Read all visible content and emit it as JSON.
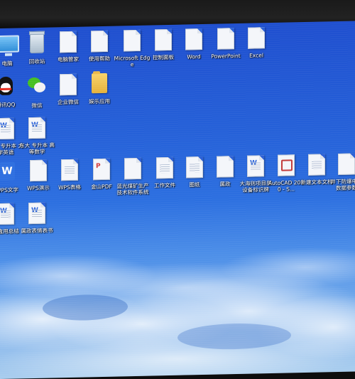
{
  "desktop": {
    "row1": [
      {
        "label": "电脑",
        "icon": "computer-icon"
      },
      {
        "label": "回收站",
        "icon": "recycle-bin-icon"
      },
      {
        "label": "电脑管家",
        "icon": "document-icon"
      },
      {
        "label": "使用帮助",
        "icon": "document-icon"
      },
      {
        "label": "Microsoft Edge",
        "icon": "document-icon"
      },
      {
        "label": "控制面板",
        "icon": "document-icon"
      },
      {
        "label": "Word",
        "icon": "document-icon"
      },
      {
        "label": "PowerPoint",
        "icon": "document-icon"
      },
      {
        "label": "Excel",
        "icon": "document-icon"
      }
    ],
    "row2": [
      {
        "label": "腾讯QQ",
        "icon": "qq-icon"
      },
      {
        "label": "微信",
        "icon": "wechat-icon"
      },
      {
        "label": "企业微信",
        "icon": "document-icon"
      },
      {
        "label": "娱乐应用",
        "icon": "folder-icon"
      }
    ],
    "row3": [
      {
        "label": "东大 专升本 大学英语",
        "icon": "wps-doc-icon"
      },
      {
        "label": "东大 专升本 高等数学",
        "icon": "wps-doc-icon"
      }
    ],
    "row4": [
      {
        "label": "WPS文字",
        "icon": "wps-writer-icon"
      },
      {
        "label": "WPS演示",
        "icon": "document-icon"
      },
      {
        "label": "WPS表格",
        "icon": "document-icon"
      },
      {
        "label": "金山PDF",
        "icon": "pdf-doc-icon"
      },
      {
        "label": "蓝光煤矿生产技术软件系统",
        "icon": "document-icon"
      },
      {
        "label": "工作文件",
        "icon": "document-icon"
      },
      {
        "label": "图纸",
        "icon": "document-icon"
      },
      {
        "label": "属政",
        "icon": "document-icon"
      },
      {
        "label": "大海则项目部设备标识牌",
        "icon": "wps-doc-icon"
      },
      {
        "label": "AutoCAD 2010 - S...",
        "icon": "autocad-icon"
      },
      {
        "label": "新建文本文档",
        "icon": "document-icon"
      },
      {
        "label": "井下防爆电器数据参数",
        "icon": "document-icon"
      }
    ],
    "row5": [
      {
        "label": "文盒用总结",
        "icon": "wps-doc-icon"
      },
      {
        "label": "属政表情表书",
        "icon": "wps-doc-icon"
      }
    ]
  }
}
